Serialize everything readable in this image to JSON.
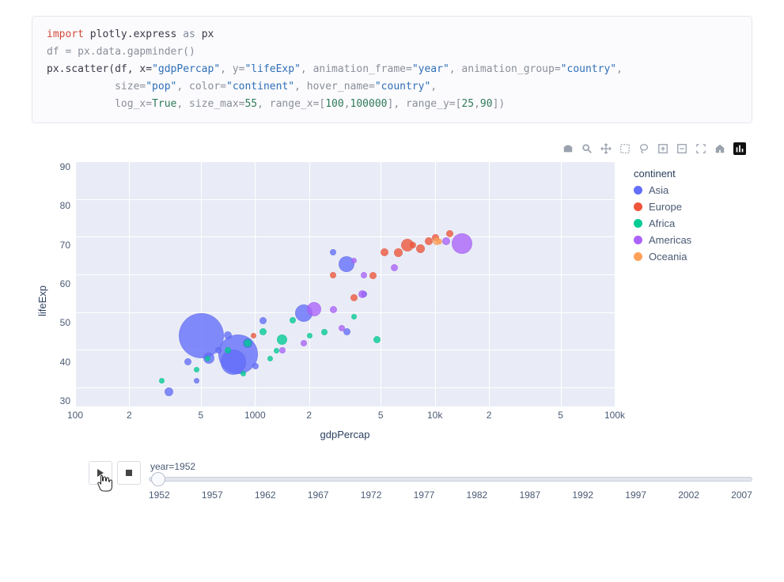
{
  "code": {
    "l1_import": "import",
    "l1_mod": "plotly.express",
    "l1_as": "as",
    "l1_alias": "px",
    "l2": "df = px.data.gapminder()",
    "l3_call": "px.scatter(df, x=",
    "l3_s1": "\"gdpPercap\"",
    "l3_p2": ", y=",
    "l3_s2": "\"lifeExp\"",
    "l3_p3": ", animation_frame=",
    "l3_s3": "\"year\"",
    "l3_p4": ", animation_group=",
    "l3_s4": "\"country\"",
    "l3_p5": ",",
    "l4_indent": "           size=",
    "l4_s1": "\"pop\"",
    "l4_p2": ", color=",
    "l4_s2": "\"continent\"",
    "l4_p3": ", hover_name=",
    "l4_s3": "\"country\"",
    "l4_p4": ",",
    "l5_indent": "           log_x=",
    "l5_b1": "True",
    "l5_p2": ", size_max=",
    "l5_n1": "55",
    "l5_p3": ", range_x=[",
    "l5_n2": "100",
    "l5_p3b": ",",
    "l5_n3": "100000",
    "l5_p4": "], range_y=[",
    "l5_n4": "25",
    "l5_p4b": ",",
    "l5_n5": "90",
    "l5_p5": "])"
  },
  "toolbar": {
    "icons": [
      "camera",
      "zoom",
      "pan",
      "box-select",
      "lasso",
      "zoom-in",
      "zoom-out",
      "autoscale",
      "home",
      "plotly-logo"
    ]
  },
  "axes": {
    "ylabel": "lifeExp",
    "xlabel": "gdpPercap",
    "yticks": [
      "90",
      "80",
      "70",
      "60",
      "50",
      "40",
      "30"
    ],
    "xticks": [
      {
        "label": "100",
        "pct": 0
      },
      {
        "label": "2",
        "pct": 10.03
      },
      {
        "label": "5",
        "pct": 23.3
      },
      {
        "label": "1000",
        "pct": 33.33
      },
      {
        "label": "2",
        "pct": 43.36
      },
      {
        "label": "5",
        "pct": 56.63
      },
      {
        "label": "10k",
        "pct": 66.67
      },
      {
        "label": "2",
        "pct": 76.7
      },
      {
        "label": "5",
        "pct": 89.97
      },
      {
        "label": "100k",
        "pct": 100
      }
    ]
  },
  "legend": {
    "title": "continent",
    "items": [
      {
        "label": "Asia",
        "color": "#636efa"
      },
      {
        "label": "Europe",
        "color": "#EF553B"
      },
      {
        "label": "Africa",
        "color": "#00cc96"
      },
      {
        "label": "Americas",
        "color": "#ab63fa"
      },
      {
        "label": "Oceania",
        "color": "#FFA15A"
      }
    ]
  },
  "animation": {
    "frame_label": "year=1952",
    "years": [
      "1952",
      "1957",
      "1962",
      "1967",
      "1972",
      "1977",
      "1982",
      "1987",
      "1992",
      "1997",
      "2002",
      "2007"
    ]
  },
  "chart_data": {
    "type": "scatter",
    "title": "",
    "xlabel": "gdpPercap",
    "ylabel": "lifeExp",
    "xlim": [
      100,
      100000
    ],
    "ylim": [
      25,
      90
    ],
    "log_x": true,
    "size_encoding": "pop",
    "color_encoding": "continent",
    "animation_frame": "year",
    "current_frame": 1952,
    "legend_position": "right",
    "series": [
      {
        "name": "Asia",
        "color": "#636efa",
        "points": [
          {
            "x": 500,
            "y": 44,
            "size": 55
          },
          {
            "x": 800,
            "y": 39,
            "size": 48
          },
          {
            "x": 330,
            "y": 29,
            "size": 9
          },
          {
            "x": 750,
            "y": 37,
            "size": 30
          },
          {
            "x": 550,
            "y": 38,
            "size": 12
          },
          {
            "x": 900,
            "y": 42,
            "size": 10
          },
          {
            "x": 1850,
            "y": 50,
            "size": 20
          },
          {
            "x": 3200,
            "y": 63,
            "size": 18
          },
          {
            "x": 700,
            "y": 44,
            "size": 8
          },
          {
            "x": 420,
            "y": 37,
            "size": 7
          },
          {
            "x": 620,
            "y": 40,
            "size": 6
          },
          {
            "x": 470,
            "y": 32,
            "size": 5
          },
          {
            "x": 1100,
            "y": 48,
            "size": 7
          },
          {
            "x": 3200,
            "y": 45,
            "size": 7
          },
          {
            "x": 1000,
            "y": 36,
            "size": 6
          },
          {
            "x": 4000,
            "y": 55,
            "size": 6
          },
          {
            "x": 2700,
            "y": 66,
            "size": 6
          }
        ]
      },
      {
        "name": "Europe",
        "color": "#EF553B",
        "points": [
          {
            "x": 974,
            "y": 44,
            "size": 5
          },
          {
            "x": 3500,
            "y": 54,
            "size": 7
          },
          {
            "x": 4500,
            "y": 60,
            "size": 7
          },
          {
            "x": 5200,
            "y": 66,
            "size": 8
          },
          {
            "x": 6200,
            "y": 66,
            "size": 9
          },
          {
            "x": 7000,
            "y": 68,
            "size": 14
          },
          {
            "x": 8200,
            "y": 67,
            "size": 9
          },
          {
            "x": 9200,
            "y": 69,
            "size": 8
          },
          {
            "x": 10000,
            "y": 70,
            "size": 7
          },
          {
            "x": 12000,
            "y": 71,
            "size": 7
          },
          {
            "x": 7500,
            "y": 68,
            "size": 6
          },
          {
            "x": 2700,
            "y": 60,
            "size": 6
          }
        ]
      },
      {
        "name": "Africa",
        "color": "#00cc96",
        "points": [
          {
            "x": 300,
            "y": 32,
            "size": 5
          },
          {
            "x": 470,
            "y": 35,
            "size": 5
          },
          {
            "x": 540,
            "y": 38,
            "size": 5
          },
          {
            "x": 700,
            "y": 40,
            "size": 6
          },
          {
            "x": 900,
            "y": 42,
            "size": 8
          },
          {
            "x": 1100,
            "y": 45,
            "size": 7
          },
          {
            "x": 1400,
            "y": 43,
            "size": 11
          },
          {
            "x": 1600,
            "y": 48,
            "size": 6
          },
          {
            "x": 2400,
            "y": 45,
            "size": 6
          },
          {
            "x": 4700,
            "y": 43,
            "size": 7
          },
          {
            "x": 1200,
            "y": 38,
            "size": 5
          },
          {
            "x": 850,
            "y": 34,
            "size": 5
          },
          {
            "x": 1300,
            "y": 40,
            "size": 5
          },
          {
            "x": 2000,
            "y": 44,
            "size": 5
          },
          {
            "x": 3500,
            "y": 49,
            "size": 5
          }
        ]
      },
      {
        "name": "Americas",
        "color": "#ab63fa",
        "points": [
          {
            "x": 14000,
            "y": 68.5,
            "size": 24
          },
          {
            "x": 11400,
            "y": 69,
            "size": 8
          },
          {
            "x": 5900,
            "y": 62,
            "size": 7
          },
          {
            "x": 3900,
            "y": 55,
            "size": 8
          },
          {
            "x": 2700,
            "y": 51,
            "size": 7
          },
          {
            "x": 2100,
            "y": 51,
            "size": 16
          },
          {
            "x": 3000,
            "y": 46,
            "size": 6
          },
          {
            "x": 1850,
            "y": 42,
            "size": 6
          },
          {
            "x": 1400,
            "y": 40,
            "size": 6
          },
          {
            "x": 4000,
            "y": 60,
            "size": 6
          },
          {
            "x": 3500,
            "y": 64,
            "size": 5
          }
        ]
      },
      {
        "name": "Oceania",
        "color": "#FFA15A",
        "points": [
          {
            "x": 10100,
            "y": 69,
            "size": 8
          },
          {
            "x": 10500,
            "y": 69,
            "size": 5
          }
        ]
      }
    ]
  }
}
